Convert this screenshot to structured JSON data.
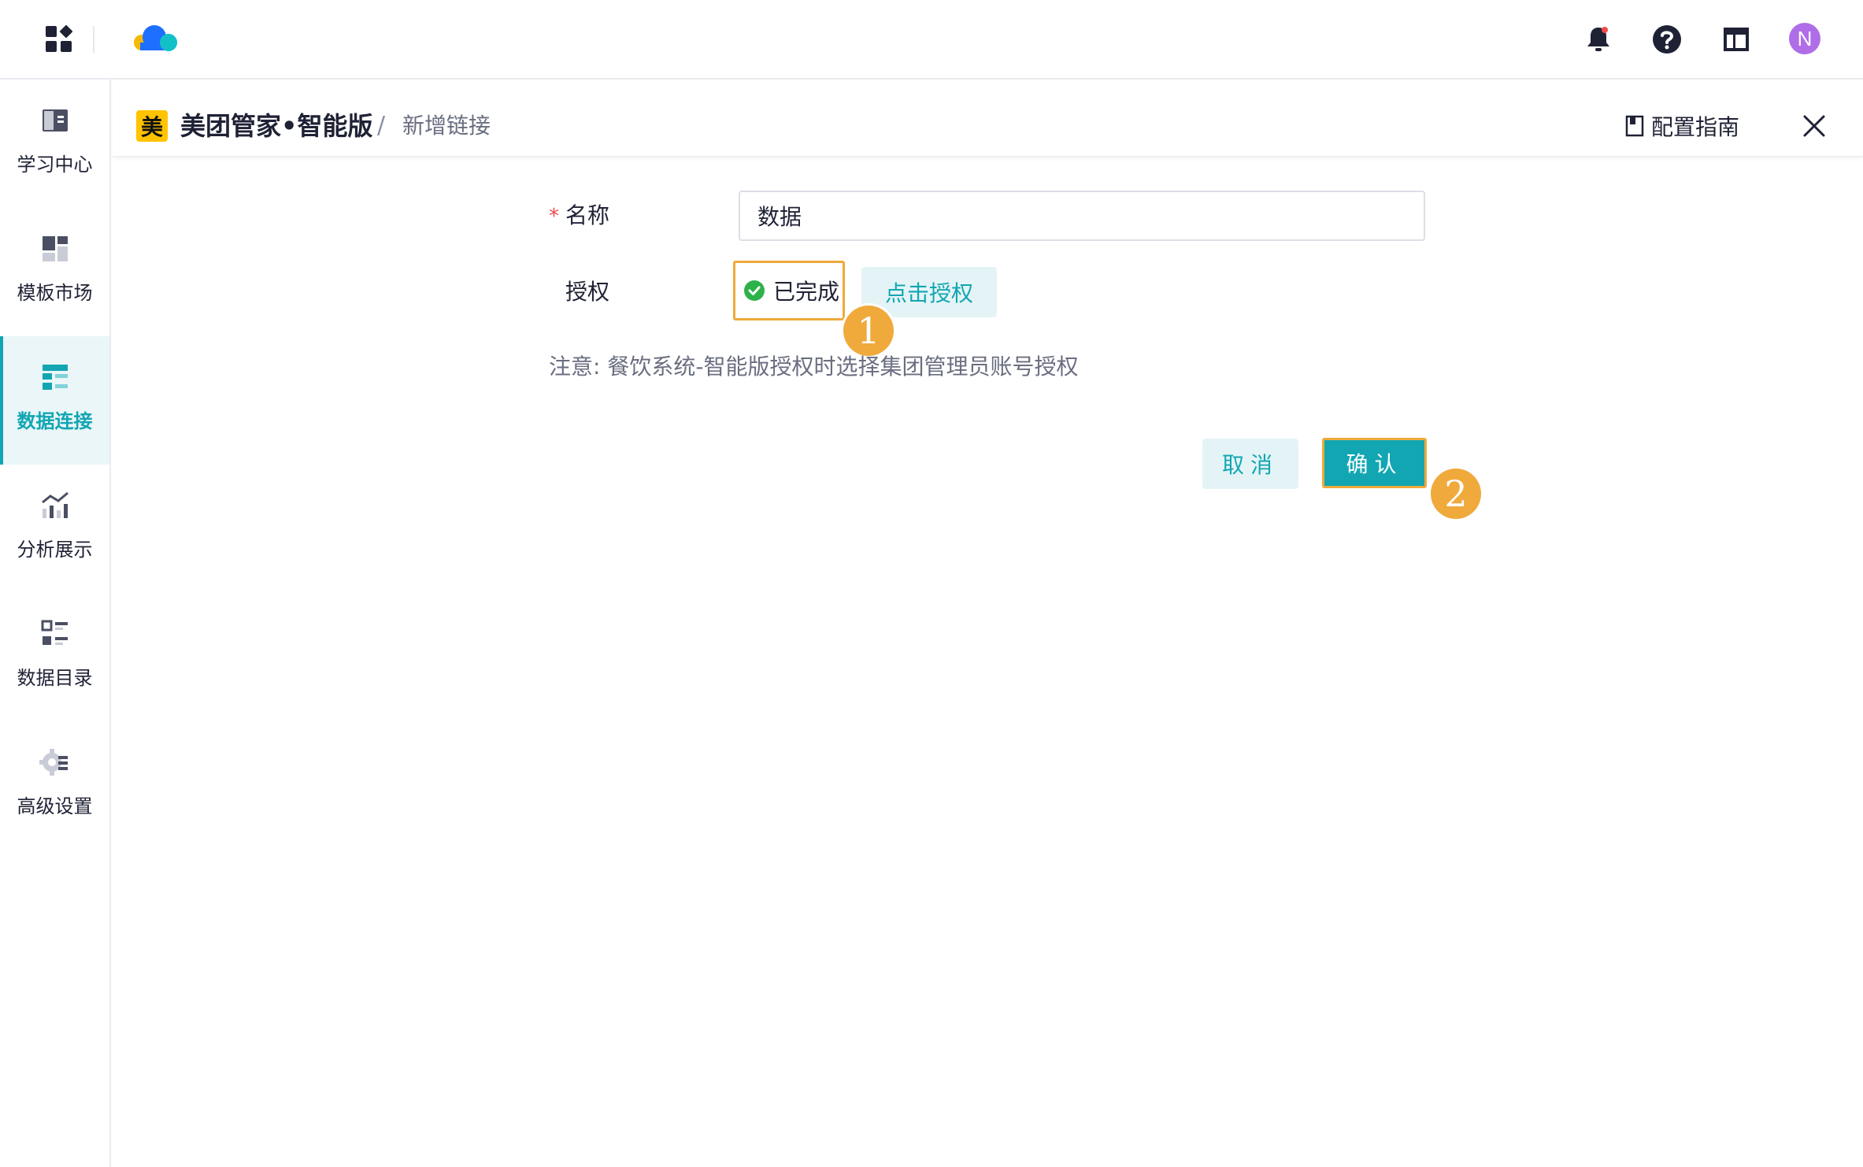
{
  "topbar": {
    "icons": [
      "apps-icon",
      "cloud-logo",
      "bell-icon",
      "help-icon",
      "layout-icon"
    ],
    "avatar_letter": "N",
    "colors": {
      "accent": "#12a6b3",
      "avatar": "#b06de8",
      "logo_blue": "#1e6fff",
      "logo_cyan": "#12c0c8",
      "logo_yellow": "#f5b800"
    }
  },
  "sidebar": {
    "items": [
      {
        "label": "学习中心",
        "icon": "book-icon",
        "active": false
      },
      {
        "label": "模板市场",
        "icon": "template-icon",
        "active": false
      },
      {
        "label": "数据连接",
        "icon": "data-connect-icon",
        "active": true
      },
      {
        "label": "分析展示",
        "icon": "analysis-icon",
        "active": false
      },
      {
        "label": "数据目录",
        "icon": "catalog-icon",
        "active": false
      },
      {
        "label": "高级设置",
        "icon": "settings-icon",
        "active": false
      }
    ]
  },
  "header": {
    "badge": "美",
    "title": "美团管家•智能版",
    "separator": "/",
    "breadcrumb": "新增链接",
    "guide_label": "配置指南"
  },
  "form": {
    "name_required_mark": "*",
    "name_label": "名称",
    "name_value": "数据",
    "auth_label": "授权",
    "auth_status": "已完成",
    "auth_button": "点击授权",
    "note": "注意: 餐饮系统-智能版授权时选择集团管理员账号授权"
  },
  "actions": {
    "cancel": "取消",
    "confirm": "确认"
  },
  "markers": [
    "1",
    "2"
  ]
}
